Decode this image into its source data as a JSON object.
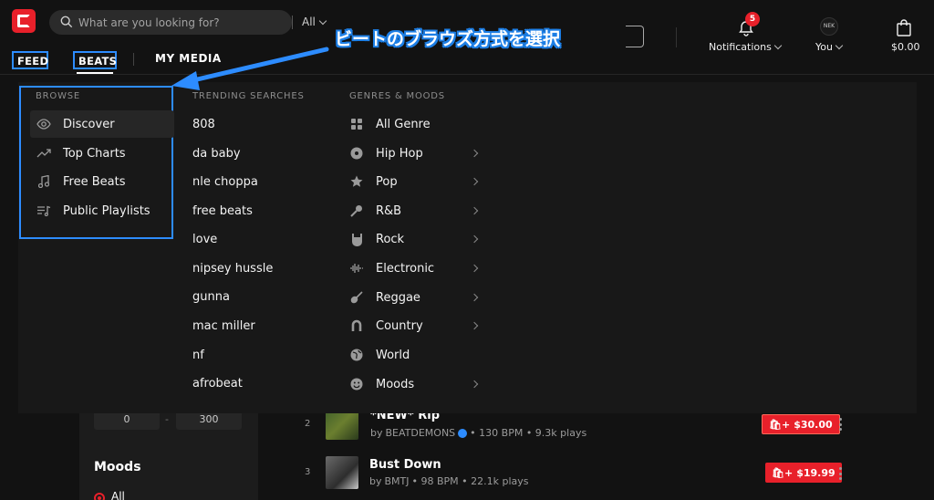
{
  "header": {
    "search_placeholder": "What are you looking for?",
    "search_scope": "All",
    "nav": {
      "feed": "FEED",
      "beats": "BEATS",
      "my_media": "MY MEDIA"
    },
    "annotation": "ビートのブラウズ方式を選択",
    "notifications": {
      "label": "Notifications",
      "count": "5"
    },
    "you": {
      "label": "You",
      "avatar_text": "NEK"
    },
    "cart_total": "$0.00"
  },
  "dropdown": {
    "browse": {
      "title": "BROWSE",
      "items": [
        {
          "label": "Discover",
          "icon": "eye-icon"
        },
        {
          "label": "Top Charts",
          "icon": "trending-up-icon"
        },
        {
          "label": "Free Beats",
          "icon": "music-note-icon"
        },
        {
          "label": "Public Playlists",
          "icon": "playlist-icon"
        }
      ]
    },
    "trending": {
      "title": "TRENDING SEARCHES",
      "items": [
        "808",
        "da baby",
        "nle choppa",
        "free beats",
        "love",
        "nipsey hussle",
        "gunna",
        "mac miller",
        "nf",
        "afrobeat"
      ]
    },
    "genres": {
      "title": "GENRES & MOODS",
      "items": [
        {
          "label": "All Genre",
          "icon": "grid-icon",
          "has_submenu": false
        },
        {
          "label": "Hip Hop",
          "icon": "vinyl-icon",
          "has_submenu": true
        },
        {
          "label": "Pop",
          "icon": "star-icon",
          "has_submenu": true
        },
        {
          "label": "R&B",
          "icon": "microphone-icon",
          "has_submenu": true
        },
        {
          "label": "Rock",
          "icon": "rock-hand-icon",
          "has_submenu": true
        },
        {
          "label": "Electronic",
          "icon": "waveform-icon",
          "has_submenu": true
        },
        {
          "label": "Reggae",
          "icon": "guitar-icon",
          "has_submenu": true
        },
        {
          "label": "Country",
          "icon": "horseshoe-icon",
          "has_submenu": true
        },
        {
          "label": "World",
          "icon": "globe-icon",
          "has_submenu": false
        },
        {
          "label": "Moods",
          "icon": "smile-icon",
          "has_submenu": true
        }
      ]
    }
  },
  "filters": {
    "bpm_min": "0",
    "bpm_max": "300",
    "moods_title": "Moods",
    "moods_selected": "All"
  },
  "tracks": [
    {
      "rank": "2",
      "title": "*NEW* Rip",
      "producer": "BEATDEMONS",
      "verified": true,
      "meta": "• 130 BPM • 9.3k plays",
      "price": "$30.00"
    },
    {
      "rank": "3",
      "title": "Bust Down",
      "producer": "BMTJ",
      "verified": false,
      "meta": "• 98 BPM • 22.1k plays",
      "price": "$19.99"
    }
  ],
  "colors": {
    "accent": "#e8202a",
    "annotation_blue": "#2d8cff",
    "background": "#121212",
    "dropdown_bg": "#181818"
  }
}
